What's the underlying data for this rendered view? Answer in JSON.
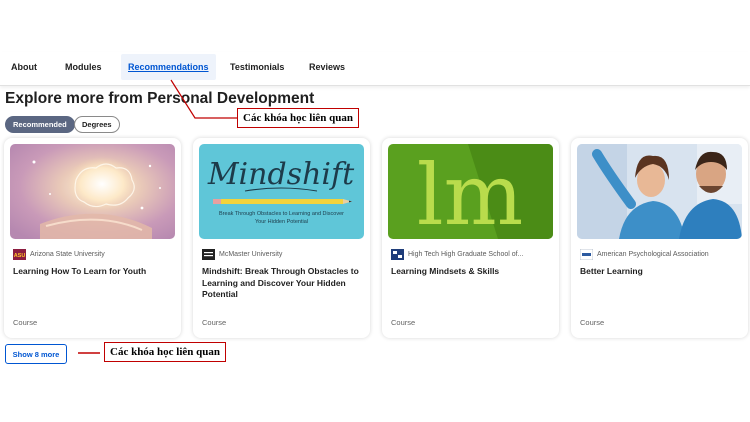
{
  "tabs": [
    {
      "label": "About"
    },
    {
      "label": "Modules"
    },
    {
      "label": "Recommendations"
    },
    {
      "label": "Testimonials"
    },
    {
      "label": "Reviews"
    }
  ],
  "section": {
    "title": "Explore more from Personal Development"
  },
  "filters": [
    {
      "label": "Recommended",
      "active": true
    },
    {
      "label": "Degrees",
      "active": false
    }
  ],
  "cards": [
    {
      "partner": "Arizona State University",
      "partner_logo_text": "ASU",
      "title": "Learning How To Learn for Youth",
      "type": "Course"
    },
    {
      "partner": "McMaster University",
      "title": "Mindshift: Break Through Obstacles to Learning and Discover Your Hidden Potential",
      "type": "Course",
      "thumb_title": "Mindshift",
      "thumb_subtitle": "Break Through Obstacles to Learning and Discover Your Hidden Potential"
    },
    {
      "partner": "High Tech High Graduate School of...",
      "title": "Learning Mindsets & Skills",
      "type": "Course",
      "thumb_title": "lm"
    },
    {
      "partner": "American Psychological Association",
      "title": "Better Learning",
      "type": "Course"
    }
  ],
  "show_more": {
    "label": "Show 8 more"
  },
  "annotations": [
    {
      "text": "Các khóa học liên quan"
    },
    {
      "text": "Các khóa học liên quan"
    }
  ],
  "colors": {
    "accent": "#0056d2",
    "chip_active": "#5b6782",
    "annotation": "#c00000"
  }
}
